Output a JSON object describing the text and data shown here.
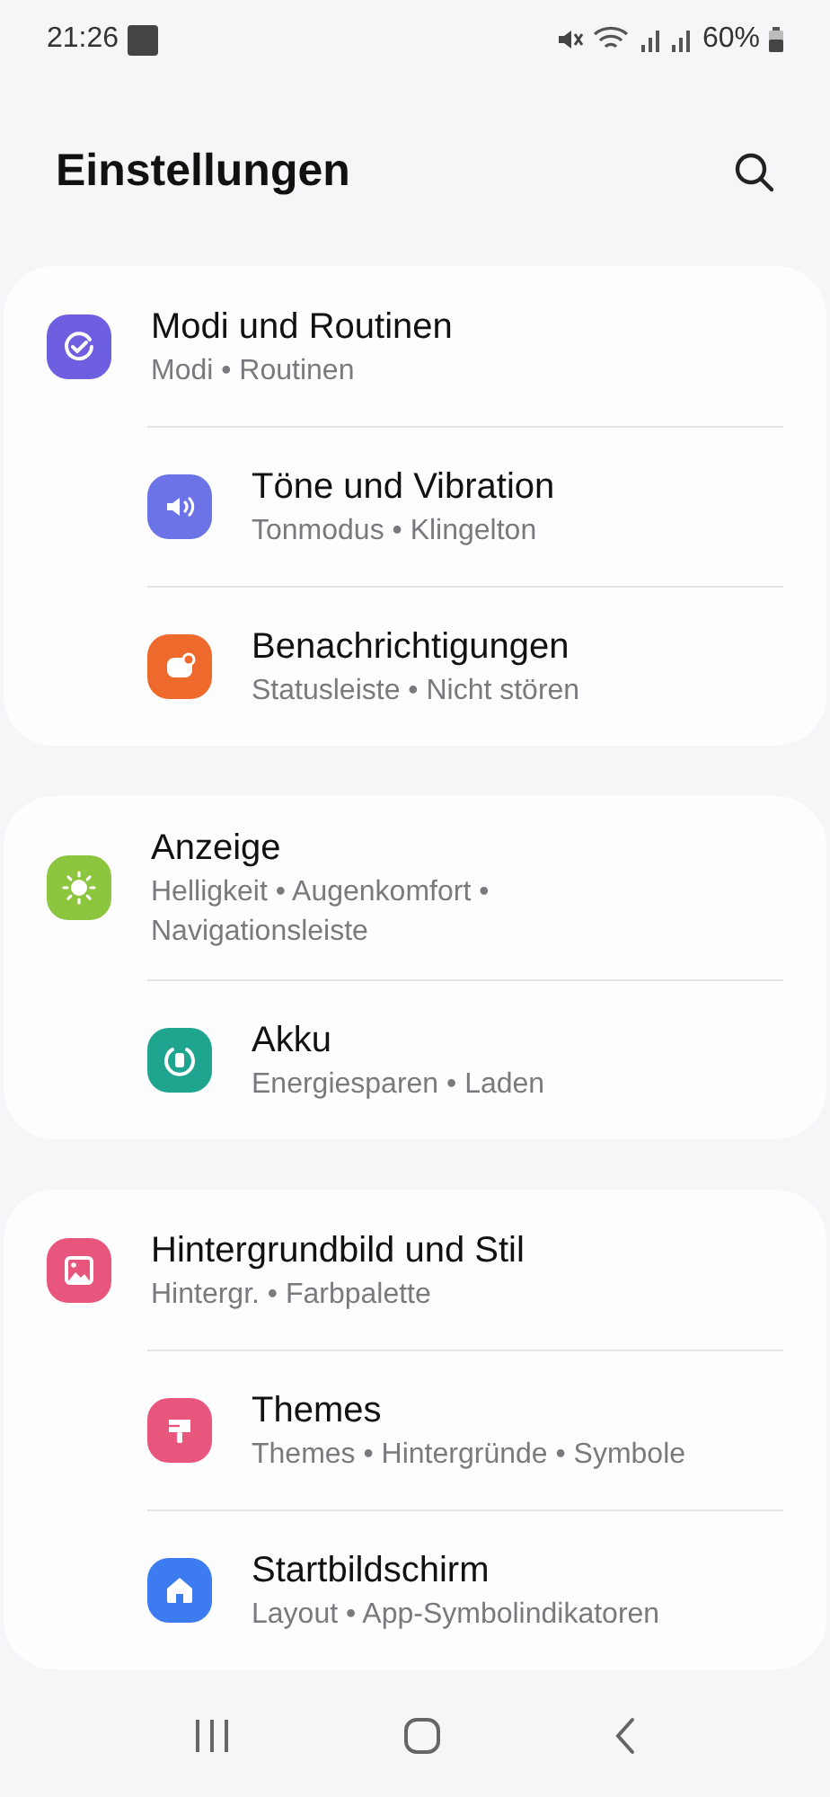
{
  "status_bar": {
    "time": "21:26",
    "battery": "60%"
  },
  "header": {
    "title": "Einstellungen"
  },
  "groups": [
    {
      "items": [
        {
          "title": "Modi und Routinen",
          "subtitle": [
            "Modi • Routinen"
          ],
          "color": "#6e5ee0"
        },
        {
          "title": "Töne und Vibration",
          "subtitle": [
            "Tonmodus • Klingelton"
          ],
          "color": "#6b73e6"
        },
        {
          "title": "Benachrichtigungen",
          "subtitle": [
            "Statusleiste • Nicht stören"
          ],
          "color": "#ee6a2c"
        }
      ]
    },
    {
      "items": [
        {
          "title": "Anzeige",
          "subtitle": [
            "Helligkeit • Augenkomfort •",
            "Navigationsleiste"
          ],
          "color": "#8cc63f"
        },
        {
          "title": "Akku",
          "subtitle": [
            "Energiesparen • Laden"
          ],
          "color": "#1fa58f"
        }
      ]
    },
    {
      "items": [
        {
          "title": "Hintergrundbild und Stil",
          "subtitle": [
            "Hintergr. • Farbpalette"
          ],
          "color": "#e8567e"
        },
        {
          "title": "Themes",
          "subtitle": [
            "Themes • Hintergründe • Symbole"
          ],
          "color": "#e8567e"
        },
        {
          "title": "Startbildschirm",
          "subtitle": [
            "Layout • App-Symbolindikatoren"
          ],
          "color": "#3d7bf0"
        }
      ]
    }
  ]
}
